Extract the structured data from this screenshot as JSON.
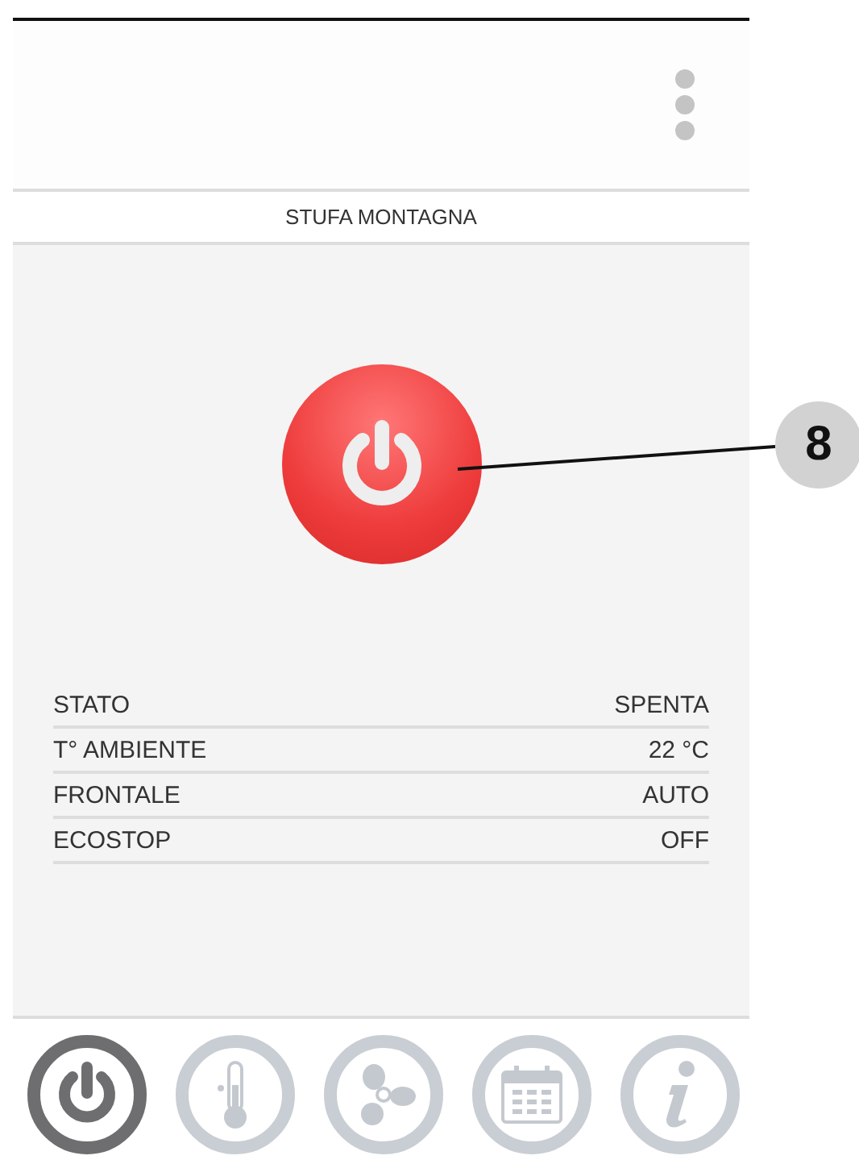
{
  "title": "STUFA MONTAGNA",
  "power_button": {
    "on": false
  },
  "status": [
    {
      "label": "STATO",
      "value": "SPENTA"
    },
    {
      "label": "T° AMBIENTE",
      "value": "22 °C"
    },
    {
      "label": "FRONTALE",
      "value": "AUTO"
    },
    {
      "label": "ECOSTOP",
      "value": "OFF"
    }
  ],
  "nav": [
    {
      "kind": "power",
      "selected": true
    },
    {
      "kind": "thermometer",
      "selected": false
    },
    {
      "kind": "fan",
      "selected": false
    },
    {
      "kind": "calendar",
      "selected": false
    },
    {
      "kind": "info",
      "selected": false
    }
  ],
  "callout": {
    "number": "8"
  }
}
